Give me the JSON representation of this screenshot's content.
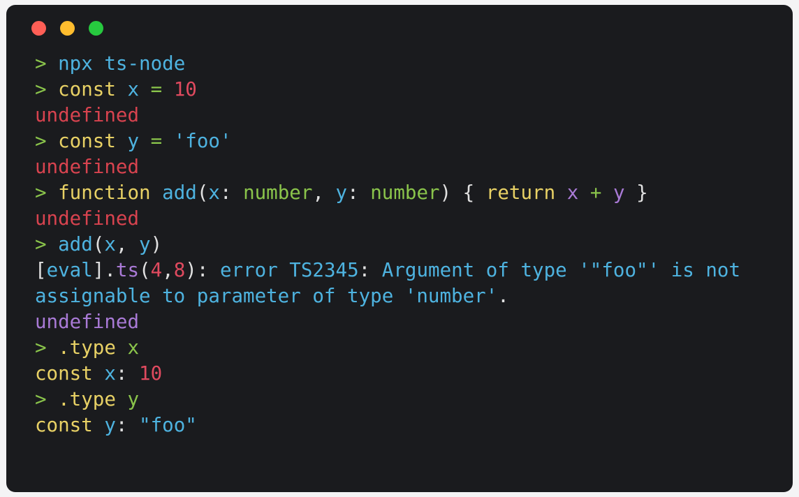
{
  "window": {
    "name": "terminal-window",
    "background": "#1a1b1e",
    "page_background": "#f4f4f5",
    "traffic_lights": [
      {
        "name": "close-button",
        "label": "close",
        "color": "#ff5f56"
      },
      {
        "name": "minimize-button",
        "label": "minimize",
        "color": "#ffbd2e"
      },
      {
        "name": "maximize-button",
        "label": "maximize",
        "color": "#27c93f"
      }
    ]
  },
  "console": {
    "lines": [
      {
        "id": "line-1",
        "tokens": [
          {
            "text": "> ",
            "style": "t-prompt"
          },
          {
            "text": "npx ts-node",
            "style": "t-fn"
          }
        ]
      },
      {
        "id": "line-2",
        "tokens": [
          {
            "text": "> ",
            "style": "t-prompt"
          },
          {
            "text": "const",
            "style": "t-kw"
          },
          {
            "text": " ",
            "style": "t-punct"
          },
          {
            "text": "x",
            "style": "t-var"
          },
          {
            "text": " ",
            "style": "t-punct"
          },
          {
            "text": "=",
            "style": "t-op"
          },
          {
            "text": " ",
            "style": "t-punct"
          },
          {
            "text": "10",
            "style": "t-num"
          }
        ]
      },
      {
        "id": "line-3",
        "tokens": [
          {
            "text": "undefined",
            "style": "t-err"
          }
        ]
      },
      {
        "id": "line-4",
        "tokens": [
          {
            "text": "> ",
            "style": "t-prompt"
          },
          {
            "text": "const",
            "style": "t-kw"
          },
          {
            "text": " ",
            "style": "t-punct"
          },
          {
            "text": "y",
            "style": "t-var"
          },
          {
            "text": " ",
            "style": "t-punct"
          },
          {
            "text": "=",
            "style": "t-op"
          },
          {
            "text": " ",
            "style": "t-punct"
          },
          {
            "text": "'foo'",
            "style": "t-str"
          }
        ]
      },
      {
        "id": "line-5",
        "tokens": [
          {
            "text": "undefined",
            "style": "t-err"
          }
        ]
      },
      {
        "id": "line-6",
        "tokens": [
          {
            "text": "> ",
            "style": "t-prompt"
          },
          {
            "text": "function",
            "style": "t-kw"
          },
          {
            "text": " ",
            "style": "t-punct"
          },
          {
            "text": "add",
            "style": "t-fn"
          },
          {
            "text": "(",
            "style": "t-punct"
          },
          {
            "text": "x",
            "style": "t-var"
          },
          {
            "text": ": ",
            "style": "t-punct"
          },
          {
            "text": "number",
            "style": "t-type"
          },
          {
            "text": ", ",
            "style": "t-punct"
          },
          {
            "text": "y",
            "style": "t-var"
          },
          {
            "text": ": ",
            "style": "t-punct"
          },
          {
            "text": "number",
            "style": "t-type"
          },
          {
            "text": ") { ",
            "style": "t-punct"
          },
          {
            "text": "return",
            "style": "t-kw"
          },
          {
            "text": " ",
            "style": "t-punct"
          },
          {
            "text": "x",
            "style": "t-purple"
          },
          {
            "text": " ",
            "style": "t-punct"
          },
          {
            "text": "+",
            "style": "t-op"
          },
          {
            "text": " ",
            "style": "t-punct"
          },
          {
            "text": "y",
            "style": "t-purple"
          },
          {
            "text": " }",
            "style": "t-punct"
          }
        ]
      },
      {
        "id": "line-7",
        "tokens": [
          {
            "text": "undefined",
            "style": "t-err"
          }
        ]
      },
      {
        "id": "line-8",
        "tokens": [
          {
            "text": "> ",
            "style": "t-prompt"
          },
          {
            "text": "add",
            "style": "t-fn"
          },
          {
            "text": "(",
            "style": "t-punct"
          },
          {
            "text": "x",
            "style": "t-var"
          },
          {
            "text": ", ",
            "style": "t-punct"
          },
          {
            "text": "y",
            "style": "t-var"
          },
          {
            "text": ")",
            "style": "t-punct"
          }
        ]
      },
      {
        "id": "line-9",
        "tokens": [
          {
            "text": "[",
            "style": "t-punct"
          },
          {
            "text": "eval",
            "style": "t-info"
          },
          {
            "text": "].",
            "style": "t-punct"
          },
          {
            "text": "ts",
            "style": "t-purple"
          },
          {
            "text": "(",
            "style": "t-punct"
          },
          {
            "text": "4",
            "style": "t-num"
          },
          {
            "text": ",",
            "style": "t-punct"
          },
          {
            "text": "8",
            "style": "t-num"
          },
          {
            "text": "): ",
            "style": "t-punct"
          },
          {
            "text": "error TS2345",
            "style": "t-info"
          },
          {
            "text": ": ",
            "style": "t-punct"
          },
          {
            "text": "Argument of type '\"foo\"' is not",
            "style": "t-info"
          }
        ]
      },
      {
        "id": "line-10",
        "tokens": [
          {
            "text": "assignable to parameter of type 'number'",
            "style": "t-info"
          },
          {
            "text": ".",
            "style": "t-punct"
          }
        ]
      },
      {
        "id": "line-11",
        "tokens": [
          {
            "text": "undefined",
            "style": "t-undef"
          }
        ]
      },
      {
        "id": "line-12",
        "tokens": [
          {
            "text": "> ",
            "style": "t-prompt"
          },
          {
            "text": ".type",
            "style": "t-kw"
          },
          {
            "text": " ",
            "style": "t-punct"
          },
          {
            "text": "x",
            "style": "t-green-id"
          }
        ]
      },
      {
        "id": "line-13",
        "tokens": [
          {
            "text": "const",
            "style": "t-kw"
          },
          {
            "text": " ",
            "style": "t-punct"
          },
          {
            "text": "x",
            "style": "t-var"
          },
          {
            "text": ": ",
            "style": "t-punct"
          },
          {
            "text": "10",
            "style": "t-num"
          }
        ]
      },
      {
        "id": "line-14",
        "tokens": [
          {
            "text": "> ",
            "style": "t-prompt"
          },
          {
            "text": ".type",
            "style": "t-kw"
          },
          {
            "text": " ",
            "style": "t-punct"
          },
          {
            "text": "y",
            "style": "t-green-id"
          }
        ]
      },
      {
        "id": "line-15",
        "tokens": [
          {
            "text": "const",
            "style": "t-kw"
          },
          {
            "text": " ",
            "style": "t-punct"
          },
          {
            "text": "y",
            "style": "t-var"
          },
          {
            "text": ": ",
            "style": "t-punct"
          },
          {
            "text": "\"foo\"",
            "style": "t-str"
          }
        ]
      }
    ]
  }
}
